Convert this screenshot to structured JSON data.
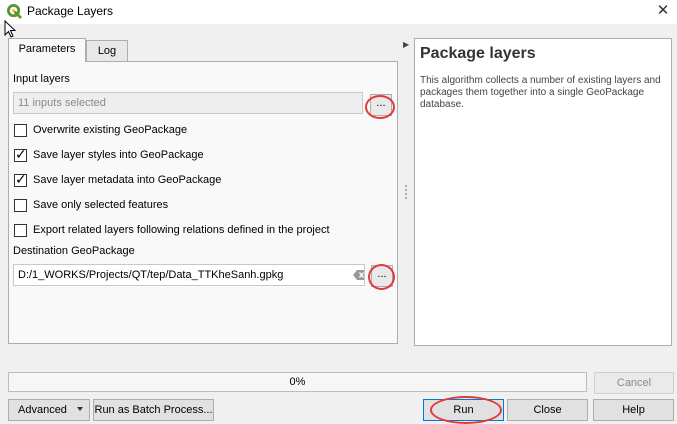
{
  "window": {
    "title": "Package Layers",
    "close_glyph": "✕",
    "app_icon": "qgis-logo-icon"
  },
  "tabs": [
    {
      "label": "Parameters",
      "active": true
    },
    {
      "label": "Log",
      "active": false
    }
  ],
  "parameters": {
    "input_layers_label": "Input layers",
    "input_layers_value": "11 inputs selected",
    "browse_label": "...",
    "checkboxes": [
      {
        "label": "Overwrite existing GeoPackage",
        "checked": false
      },
      {
        "label": "Save layer styles into GeoPackage",
        "checked": true
      },
      {
        "label": "Save layer metadata into GeoPackage",
        "checked": true
      },
      {
        "label": "Save only selected features",
        "checked": false
      },
      {
        "label": "Export related layers following relations defined in the project",
        "checked": false
      }
    ],
    "destination_label": "Destination GeoPackage",
    "destination_value": "D:/1_WORKS/Projects/QT/tep/Data_TTKheSanh.gpkg",
    "destination_browse_label": "..."
  },
  "help": {
    "title": "Package layers",
    "body": "This algorithm collects a number of existing layers and packages them together into a single GeoPackage database."
  },
  "progress": {
    "percent": 0,
    "text": "0%"
  },
  "buttons": {
    "cancel": "Cancel",
    "advanced": "Advanced",
    "batch": "Run as Batch Process...",
    "run": "Run",
    "close": "Close",
    "help": "Help"
  },
  "colors": {
    "annotation_red": "#e23a3a",
    "qgis_green": "#589632",
    "focus_blue": "#0078d7"
  }
}
